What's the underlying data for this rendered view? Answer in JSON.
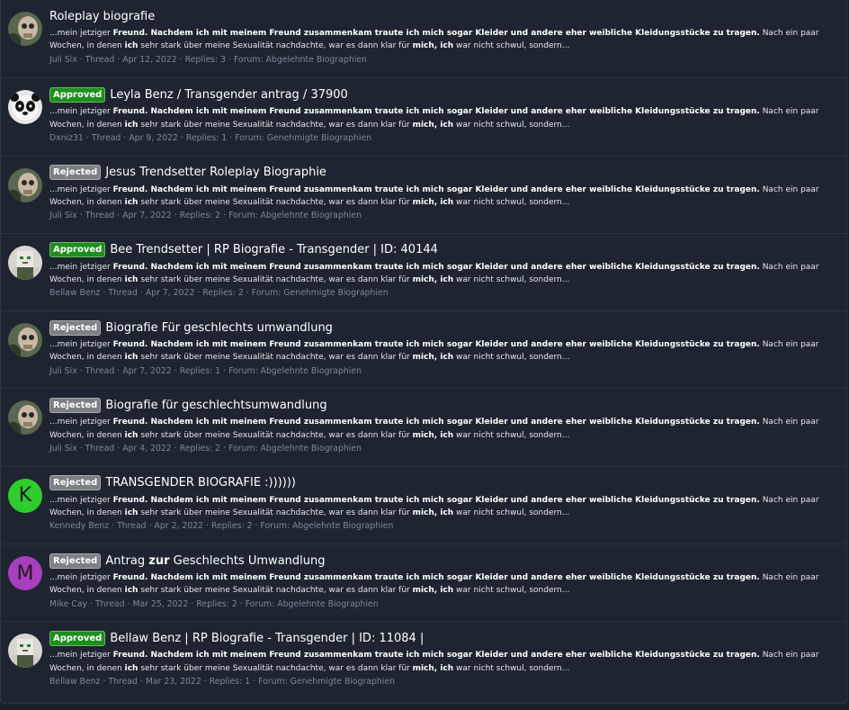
{
  "snippet": {
    "lead": "...mein jetziger ",
    "b1": "Freund. Nachdem ich mit meinem Freund zusammenkam traute ich mich sogar Kleider und andere eher weibliche Kleidungsstücke zu tragen.",
    "mid1": " Nach ein paar Wochen, in denen ",
    "b2": "ich",
    "line2": " sehr stark über meine Sexualität nachdachte, war es dann klar für ",
    "b3": "mich, ich",
    "end": " war nicht schwul, sondern..."
  },
  "meta_sep": "·",
  "results": [
    {
      "avatar": "skull-photo-avatar",
      "badge": "",
      "title_pre": "Roleplay biografie",
      "title_bold": "",
      "title_post": "",
      "author": "Juli Six",
      "type": "Thread",
      "date": "Apr 12, 2022",
      "replies": "Replies: 3",
      "forum": "Forum: Abgelehnte Biographien"
    },
    {
      "avatar": "panda-avatar",
      "badge": "Approved",
      "title_pre": "Leyla Benz / Transgender antrag / 37900",
      "title_bold": "",
      "title_post": "",
      "author": "Dxniz31",
      "type": "Thread",
      "date": "Apr 9, 2022",
      "replies": "Replies: 1",
      "forum": "Forum: Genehmigte Biographien"
    },
    {
      "avatar": "skull-photo-avatar",
      "badge": "Rejected",
      "title_pre": "Jesus Trendsetter Roleplay Biographie",
      "title_bold": "",
      "title_post": "",
      "author": "Juli Six",
      "type": "Thread",
      "date": "Apr 7, 2022",
      "replies": "Replies: 2",
      "forum": "Forum: Abgelehnte Biographien"
    },
    {
      "avatar": "minecraft-avatar",
      "badge": "Approved",
      "title_pre": "Bee Trendsetter | RP Biografie - Transgender | ID: 40144",
      "title_bold": "",
      "title_post": "",
      "author": "Bellaw Benz",
      "type": "Thread",
      "date": "Apr 7, 2022",
      "replies": "Replies: 2",
      "forum": "Forum: Genehmigte Biographien"
    },
    {
      "avatar": "skull-photo-avatar",
      "badge": "Rejected",
      "title_pre": "Biografie Für geschlechts umwandlung",
      "title_bold": "",
      "title_post": "",
      "author": "Juli Six",
      "type": "Thread",
      "date": "Apr 7, 2022",
      "replies": "Replies: 1",
      "forum": "Forum: Abgelehnte Biographien"
    },
    {
      "avatar": "skull-photo-avatar",
      "badge": "Rejected",
      "title_pre": "Biografie für geschlechtsumwandlung",
      "title_bold": "",
      "title_post": "",
      "author": "Juli Six",
      "type": "Thread",
      "date": "Apr 4, 2022",
      "replies": "Replies: 2",
      "forum": "Forum: Abgelehnte Biographien"
    },
    {
      "avatar": "letter-avatar",
      "avatar_letter": "K",
      "avatar_color": "#2ecc2e",
      "badge": "Rejected",
      "title_pre": "TRANSGENDER BIOGRAFIE :))))))",
      "title_bold": "",
      "title_post": "",
      "author": "Kennedy Benz",
      "type": "Thread",
      "date": "Apr 2, 2022",
      "replies": "Replies: 2",
      "forum": "Forum: Abgelehnte Biographien"
    },
    {
      "avatar": "letter-avatar",
      "avatar_letter": "M",
      "avatar_color": "#a83fbf",
      "badge": "Rejected",
      "title_pre": "Antrag ",
      "title_bold": "zur",
      "title_post": " Geschlechts Umwandlung",
      "author": "Mike Cay",
      "type": "Thread",
      "date": "Mar 25, 2022",
      "replies": "Replies: 2",
      "forum": "Forum: Abgelehnte Biographien"
    },
    {
      "avatar": "minecraft-avatar",
      "badge": "Approved",
      "title_pre": "Bellaw Benz | RP Biografie - Transgender | ID: 11084 |",
      "title_bold": "",
      "title_post": "",
      "author": "Bellaw Benz",
      "type": "Thread",
      "date": "Mar 23, 2022",
      "replies": "Replies: 1",
      "forum": "Forum: Genehmigte Biographien"
    }
  ]
}
